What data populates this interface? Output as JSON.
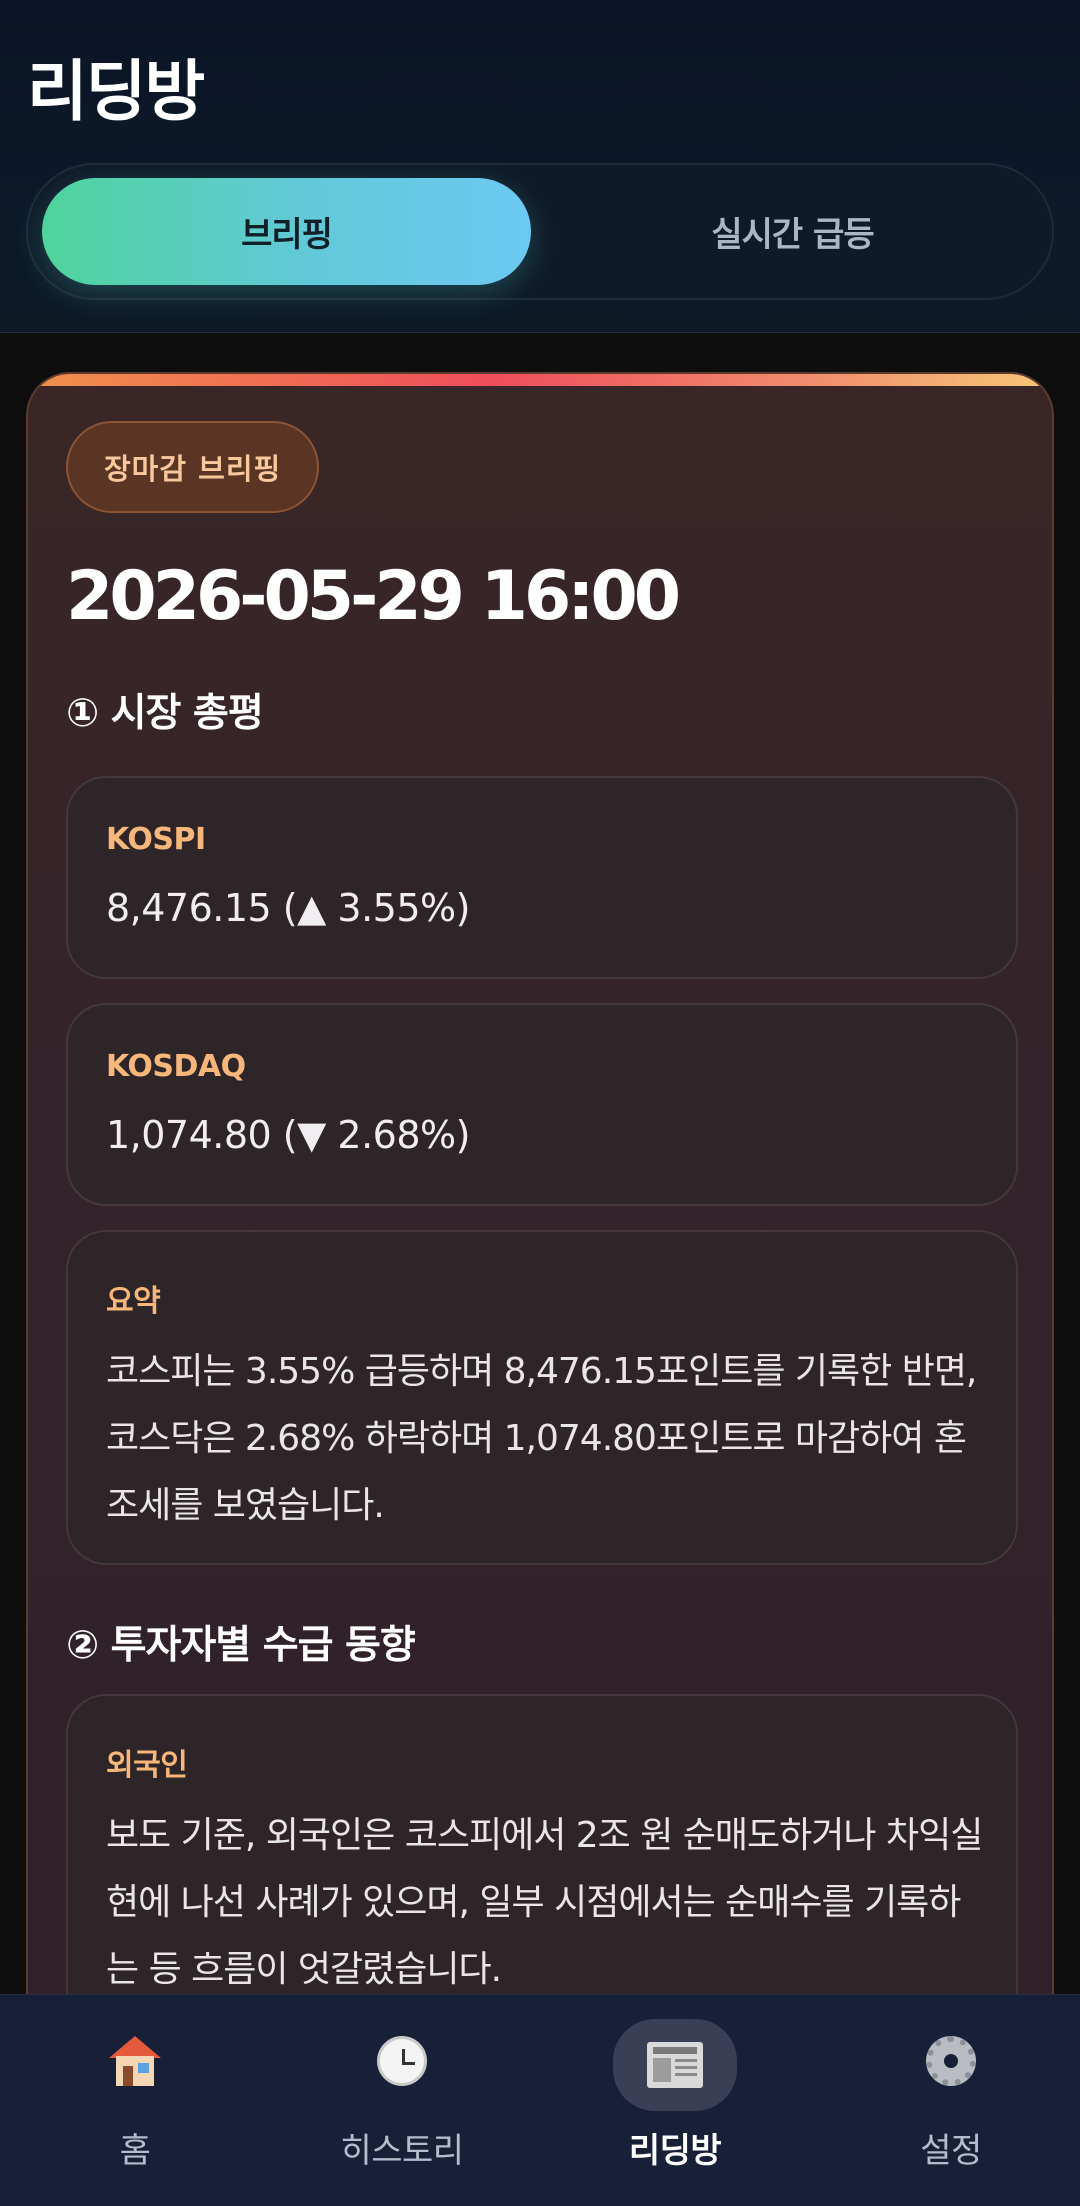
{
  "header": {
    "title": "리딩방",
    "tabs": [
      {
        "label": "브리핑",
        "active": true
      },
      {
        "label": "실시간 급등",
        "active": false
      }
    ]
  },
  "briefing": {
    "badge": "장마감 브리핑",
    "datetime": "2026-05-29 16:00",
    "sections": [
      {
        "title": "① 시장 총평",
        "indices": [
          {
            "label": "KOSPI",
            "value": "8,476.15 (▲ 3.55%)"
          },
          {
            "label": "KOSDAQ",
            "value": "1,074.80 (▼ 2.68%)"
          }
        ],
        "summary": {
          "label": "요약",
          "text": "코스피는 3.55% 급등하며 8,476.15포인트를 기록한 반면, 코스닥은 2.68% 하락하며 1,074.80포인트로 마감하여 혼조세를 보였습니다."
        }
      },
      {
        "title": "② 투자자별 수급 동향",
        "items": [
          {
            "label": "외국인",
            "text": "보도 기준, 외국인은 코스피에서 2조 원 순매도하거나 차익실현에 나선 사례가 있으며, 일부 시점에서는 순매수를 기록하는 등 흐름이 엇갈렸습니다."
          }
        ]
      }
    ]
  },
  "bottom_nav": {
    "items": [
      {
        "label": "홈",
        "icon": "house-icon",
        "active": false
      },
      {
        "label": "히스토리",
        "icon": "clock-icon",
        "active": false
      },
      {
        "label": "리딩방",
        "icon": "newspaper-icon",
        "active": true
      },
      {
        "label": "설정",
        "icon": "gear-icon",
        "active": false
      }
    ]
  },
  "colors": {
    "accent_gradient_start": "#4fd49c",
    "accent_gradient_end": "#6cc9f2",
    "label_orange": "#f7b77a",
    "nav_background": "#182038"
  }
}
